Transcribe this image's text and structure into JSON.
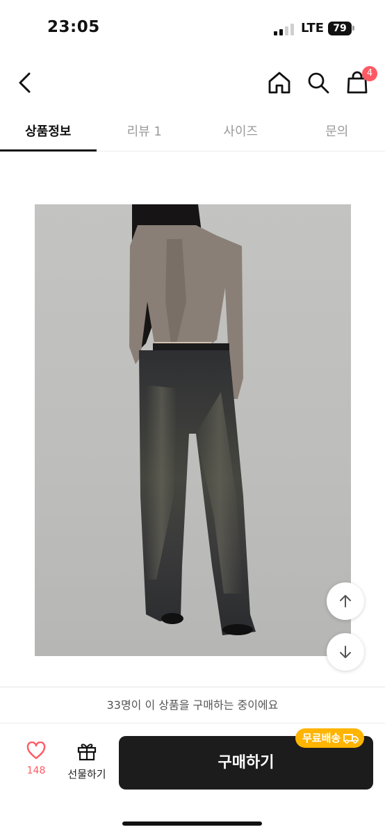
{
  "status_bar": {
    "time": "23:05",
    "network": "LTE",
    "battery": "79"
  },
  "header": {
    "back_icon": "chevron-left-icon",
    "home_icon": "home-icon",
    "search_icon": "search-icon",
    "cart_icon": "shopping-bag-icon",
    "cart_badge": "4"
  },
  "tabs": [
    {
      "label": "상품정보",
      "active": true
    },
    {
      "label": "리뷰 1",
      "active": false
    },
    {
      "label": "사이즈",
      "active": false
    },
    {
      "label": "문의",
      "active": false
    }
  ],
  "scroll": {
    "up_icon": "arrow-up-icon",
    "down_icon": "arrow-down-icon"
  },
  "bottom": {
    "notice": "33명이 이 상품을 구매하는 중이에요",
    "like_count": "148",
    "gift_label": "선물하기",
    "buy_label": "구매하기",
    "free_shipping": "무료배송"
  },
  "colors": {
    "accent_red": "#ff5a63",
    "shipping_badge": "#ffb400",
    "buy_button": "#1c1c1c"
  }
}
